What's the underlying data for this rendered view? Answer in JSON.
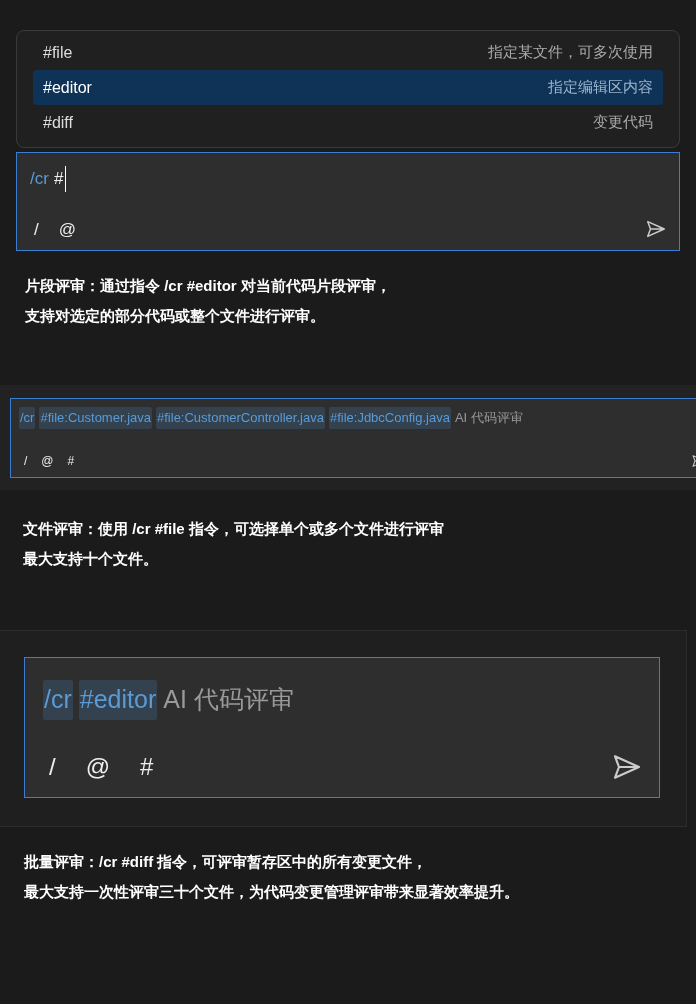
{
  "sections": [
    {
      "kind": "menu-input",
      "menu": [
        {
          "tag": "#file",
          "description": "指定某文件，可多次使用",
          "selected": false
        },
        {
          "tag": "#editor",
          "description": "指定编辑区内容",
          "selected": true
        },
        {
          "tag": "#diff",
          "description": "变更代码",
          "selected": false
        }
      ],
      "input": {
        "cursor": true,
        "tokens": [
          {
            "text": "/cr",
            "kind": "chip"
          },
          {
            "text": "#",
            "kind": "plain"
          }
        ],
        "toolbar": [
          "/",
          "@"
        ]
      },
      "caption": [
        "片段评审：通过指令 /cr #editor 对当前代码片段评审，",
        "支持对选定的部分代码或整个文件进行评审。"
      ]
    },
    {
      "kind": "compact-input",
      "input": {
        "cursor": false,
        "tokens": [
          {
            "text": "/cr",
            "kind": "chip"
          },
          {
            "text": "#file:Customer.java",
            "kind": "chip"
          },
          {
            "text": "#file:CustomerController.java",
            "kind": "chip"
          },
          {
            "text": "#file:JdbcConfig.java",
            "kind": "chip"
          },
          {
            "text": "AI 代码评审",
            "kind": "hint"
          }
        ],
        "toolbar": [
          "/",
          "@",
          "#"
        ]
      },
      "caption": [
        "文件评审：使用 /cr #file 指令，可选择单个或多个文件进行评审",
        "最大支持十个文件。"
      ]
    },
    {
      "kind": "large-input",
      "input": {
        "cursor": false,
        "tokens": [
          {
            "text": "/cr",
            "kind": "chip"
          },
          {
            "text": "#editor",
            "kind": "chip"
          },
          {
            "text": "AI 代码评审",
            "kind": "hint"
          }
        ],
        "toolbar": [
          "/",
          "@",
          "#"
        ]
      },
      "caption": [
        "批量评审：/cr #diff 指令，可评审暂存区中的所有变更文件，",
        "最大支持一次性评审三十个文件，为代码变更管理评审带来显著效率提升。"
      ]
    }
  ]
}
